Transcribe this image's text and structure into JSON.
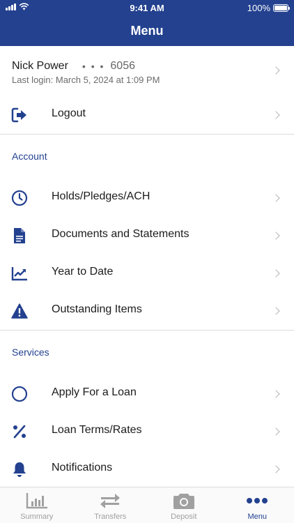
{
  "status": {
    "time": "9:41 AM",
    "battery": "100%"
  },
  "header": {
    "title": "Menu"
  },
  "user": {
    "name": "Nick Power",
    "mask": "• • •",
    "account": "6056",
    "last_login": "Last login: March 5, 2024 at 1:09 PM"
  },
  "logout": {
    "label": "Logout"
  },
  "sections": {
    "account": {
      "title": "Account",
      "items": [
        {
          "label": "Holds/Pledges/ACH",
          "icon": "clock-icon"
        },
        {
          "label": "Documents and Statements",
          "icon": "document-icon"
        },
        {
          "label": "Year to Date",
          "icon": "chart-trend-icon"
        },
        {
          "label": "Outstanding Items",
          "icon": "warning-icon"
        }
      ]
    },
    "services": {
      "title": "Services",
      "items": [
        {
          "label": "Apply For a Loan",
          "icon": "circle-icon"
        },
        {
          "label": "Loan Terms/Rates",
          "icon": "percent-icon"
        },
        {
          "label": "Notifications",
          "icon": "bell-icon"
        }
      ]
    }
  },
  "tabbar": {
    "tabs": [
      {
        "label": "Summary",
        "icon": "bar-chart-icon"
      },
      {
        "label": "Transfers",
        "icon": "transfer-arrows-icon"
      },
      {
        "label": "Deposit",
        "icon": "camera-icon"
      },
      {
        "label": "Menu",
        "icon": "more-dots-icon",
        "active": true
      }
    ]
  },
  "colors": {
    "primary": "#23418f",
    "text": "#1b1b1b",
    "muted": "#6c6c6c",
    "divider": "#dcdcdc",
    "inactive_tab": "#a0a0a0"
  }
}
